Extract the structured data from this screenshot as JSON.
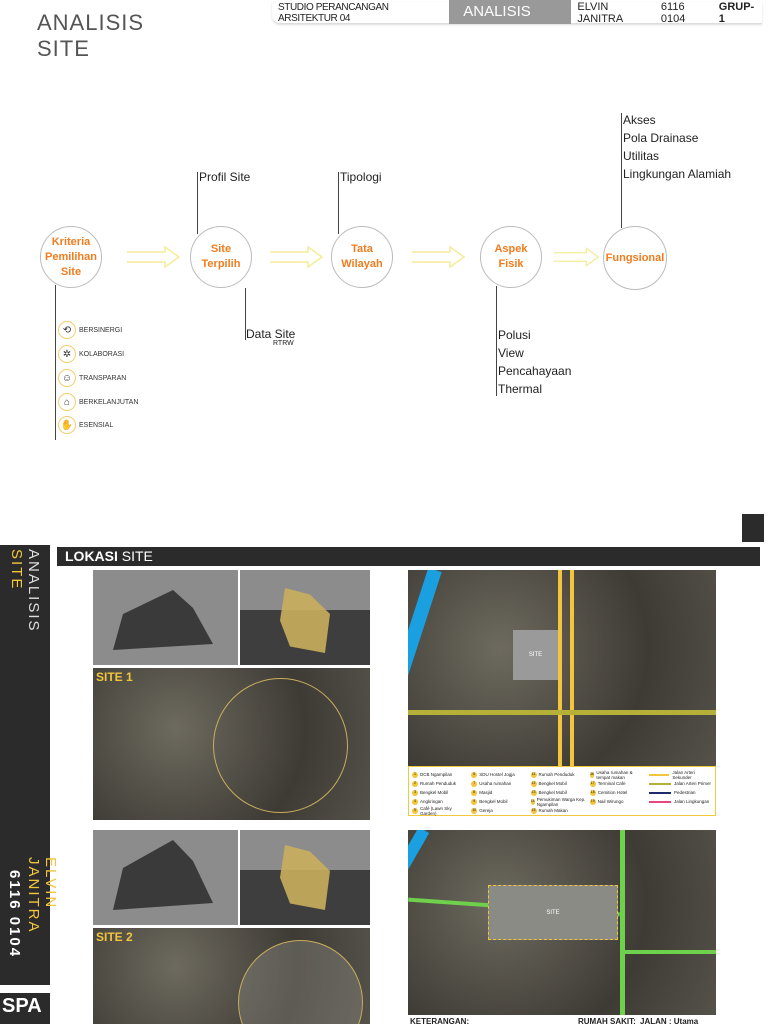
{
  "header": {
    "title_line1": "ANALISIS",
    "title_line2": "SITE",
    "studio": "STUDIO PERANCANGAN ARSITEKTUR 04",
    "section": "ANALISIS SITE",
    "author": "ELVIN JANITRA",
    "nim": "6116 0104",
    "group": "GRUP-1"
  },
  "flow": {
    "steps": [
      "Kriteria Pemilihan Site",
      "Site Terpilih",
      "Tata Wilayah",
      "Aspek Fisik",
      "Fungsional"
    ],
    "site_terpilih_top": "Profil Site",
    "site_terpilih_bottom": "Data Site",
    "site_terpilih_bottom_sub": "RTRW",
    "tata_wilayah_top": "Tipologi",
    "aspek_fisik_bottom": [
      "Polusi",
      "View",
      "Pencahayaan",
      "Thermal"
    ],
    "fungsional_top": [
      "Akses",
      "Pola Drainase",
      "Utilitas",
      "Lingkungan Alamiah"
    ],
    "criteria": [
      {
        "icon": "synergy-icon",
        "label": "BERSINERGI"
      },
      {
        "icon": "collaboration-icon",
        "label": "KOLABORASI"
      },
      {
        "icon": "transparency-icon",
        "label": "TRANSPARAN"
      },
      {
        "icon": "house-icon",
        "label": "BERKELANJUTAN"
      },
      {
        "icon": "hand-icon",
        "label": "ESENSIAL"
      }
    ]
  },
  "lower": {
    "sidebar_analisis": "ANALISIS",
    "sidebar_site": "SITE",
    "sidebar_name": "ELVIN JANITRA",
    "sidebar_nim": "6116 0104",
    "sidebar_next": "SPA",
    "bar_bold": "LOKASI",
    "bar_rest": " SITE",
    "site1": "SITE 1",
    "site1_num": "1",
    "site2": "SITE 2",
    "site2_num": "2",
    "map_site_label": "SITE",
    "legend_items": [
      "DCB Ngampilan",
      "Rumah Penduduk",
      "Bengkel Mobil",
      "Angkringan",
      "Café (Lawn Sky Garden)",
      "SDU Hostel Jogja",
      "Usaha rumahan",
      "Masjid",
      "Bengkel Mobil",
      "Gereja",
      "Rumah Penduduk",
      "Bengkel Mobil",
      "Bengkel Mobil",
      "Pemukiman Warga Kep. Ngampilan",
      "Rumah Makan",
      "Usaha rumahan & tempat makan",
      "Terminal Cafe",
      "Cemition Hotel",
      "Nail Wirungo"
    ],
    "roads": [
      {
        "label": "Jalan Arteri Sekunder",
        "color": "#f2c53d"
      },
      {
        "label": "Jalan Arteri Primer",
        "color": "#b5b038"
      },
      {
        "label": "Pedestrian",
        "color": "#1d2a6b"
      },
      {
        "label": "Jalan Lingkungan",
        "color": "#e8457a"
      }
    ],
    "keterangan": "KETERANGAN:",
    "rumah_sakit": "RUMAH SAKIT:",
    "jalan": "JALAN : Utama"
  },
  "colors": {
    "accent_orange": "#f07c1e",
    "accent_yellow": "#f2c53d",
    "dark": "#2b2b2b"
  }
}
